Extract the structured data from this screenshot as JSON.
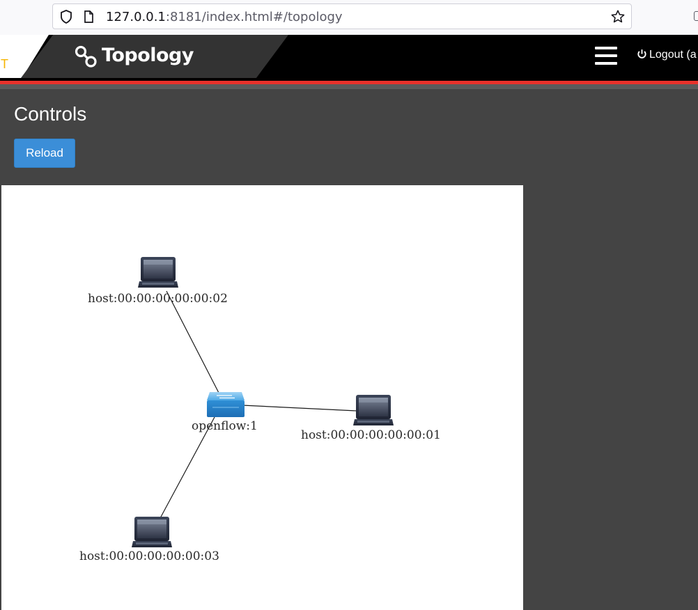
{
  "browser": {
    "url_host": "127.0.0.1",
    "url_rest": ":8181/index.html#/topology"
  },
  "header": {
    "left_fragment": "T",
    "title": "Topology",
    "logout_label": "Logout (a",
    "accent_color": "#e8322b"
  },
  "controls": {
    "title": "Controls",
    "reload_label": "Reload"
  },
  "topology": {
    "nodes": [
      {
        "id": "h2",
        "type": "host",
        "label": "host:00:00:00:00:00:02"
      },
      {
        "id": "sw",
        "type": "switch",
        "label": "openflow:1"
      },
      {
        "id": "h1",
        "type": "host",
        "label": "host:00:00:00:00:00:01"
      },
      {
        "id": "h3",
        "type": "host",
        "label": "host:00:00:00:00:00:03"
      }
    ],
    "links": [
      [
        "sw",
        "h2"
      ],
      [
        "sw",
        "h1"
      ],
      [
        "sw",
        "h3"
      ]
    ]
  }
}
